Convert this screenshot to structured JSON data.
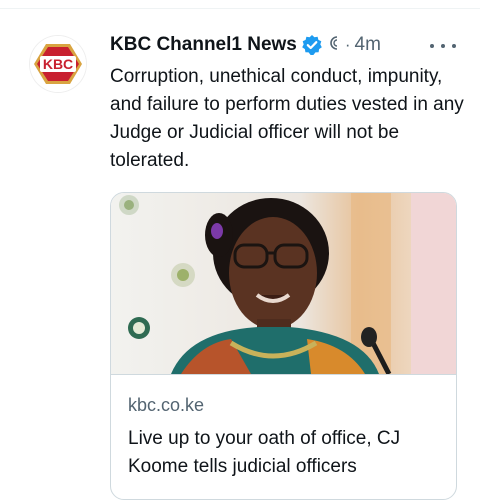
{
  "account": {
    "name": "KBC Channel1 News",
    "logo_text": "KBC",
    "verified_icon": "verified-badge-icon",
    "affiliate_icon": "affiliate-icon",
    "separator": "·",
    "timestamp": "4m"
  },
  "tweet": {
    "text": "Corruption, unethical conduct, impunity, and failure to perform duties vested in any Judge or Judicial officer will not be tolerated."
  },
  "card": {
    "domain": "kbc.co.ke",
    "title": "Live up to your oath of office, CJ Koome tells judicial officers"
  },
  "colors": {
    "verified": "#1d9bf0",
    "muted_text": "#536471",
    "logo_red": "#c8202f",
    "logo_gold": "#d9a441"
  }
}
